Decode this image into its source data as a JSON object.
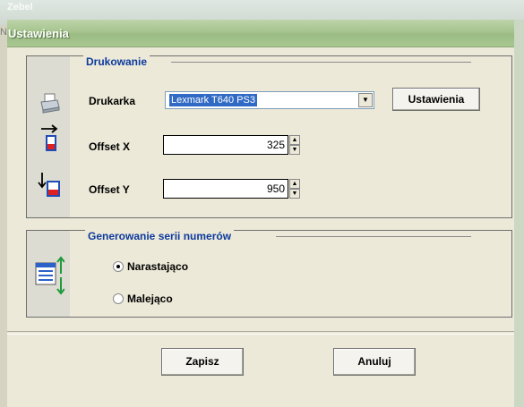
{
  "background": {
    "ghost_title": "Zebel",
    "ghost_side": "N"
  },
  "dialog": {
    "title": "Ustawienia",
    "printing": {
      "group_label": "Drukowanie",
      "printer_label": "Drukarka",
      "printer_value": "Lexmark T640 PS3",
      "settings_button": "Ustawienia",
      "offset_x_label": "Offset X",
      "offset_x_value": "325",
      "offset_y_label": "Offset Y",
      "offset_y_value": "950"
    },
    "series": {
      "group_label": "Generowanie serii numerów",
      "ascending_label": "Narastająco",
      "descending_label": "Malejąco",
      "selected": "ascending"
    },
    "buttons": {
      "save": "Zapisz",
      "cancel": "Anuluj"
    }
  }
}
